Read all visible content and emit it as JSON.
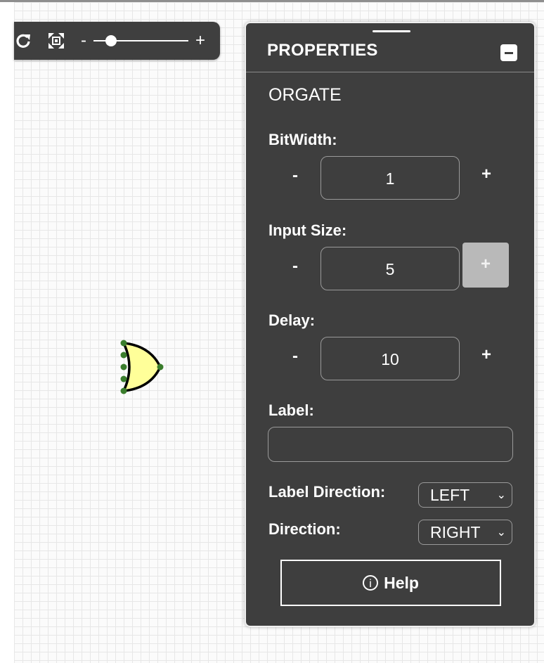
{
  "toolbar": {
    "zoom_minus": "-",
    "zoom_plus": "+",
    "zoom_fraction": 0.14
  },
  "panel": {
    "title": "PROPERTIES",
    "element_name": "ORGATE",
    "bitwidth": {
      "label": "BitWidth:",
      "minus": "-",
      "plus": "+",
      "value": "1"
    },
    "input_size": {
      "label": "Input Size:",
      "minus": "-",
      "plus": "+",
      "value": "5"
    },
    "delay": {
      "label": "Delay:",
      "minus": "-",
      "plus": "+",
      "value": "10"
    },
    "label_field": {
      "label": "Label:",
      "value": ""
    },
    "label_direction": {
      "label": "Label Direction:",
      "value": "LEFT"
    },
    "direction": {
      "label": "Direction:",
      "value": "RIGHT"
    },
    "help_label": "Help",
    "help_icon": "i"
  },
  "colors": {
    "panel_bg": "#3e3e3e",
    "gate_fill": "#ffff99",
    "node_color": "#3a7d2c",
    "disabled_btn": "#b9b9b9"
  }
}
